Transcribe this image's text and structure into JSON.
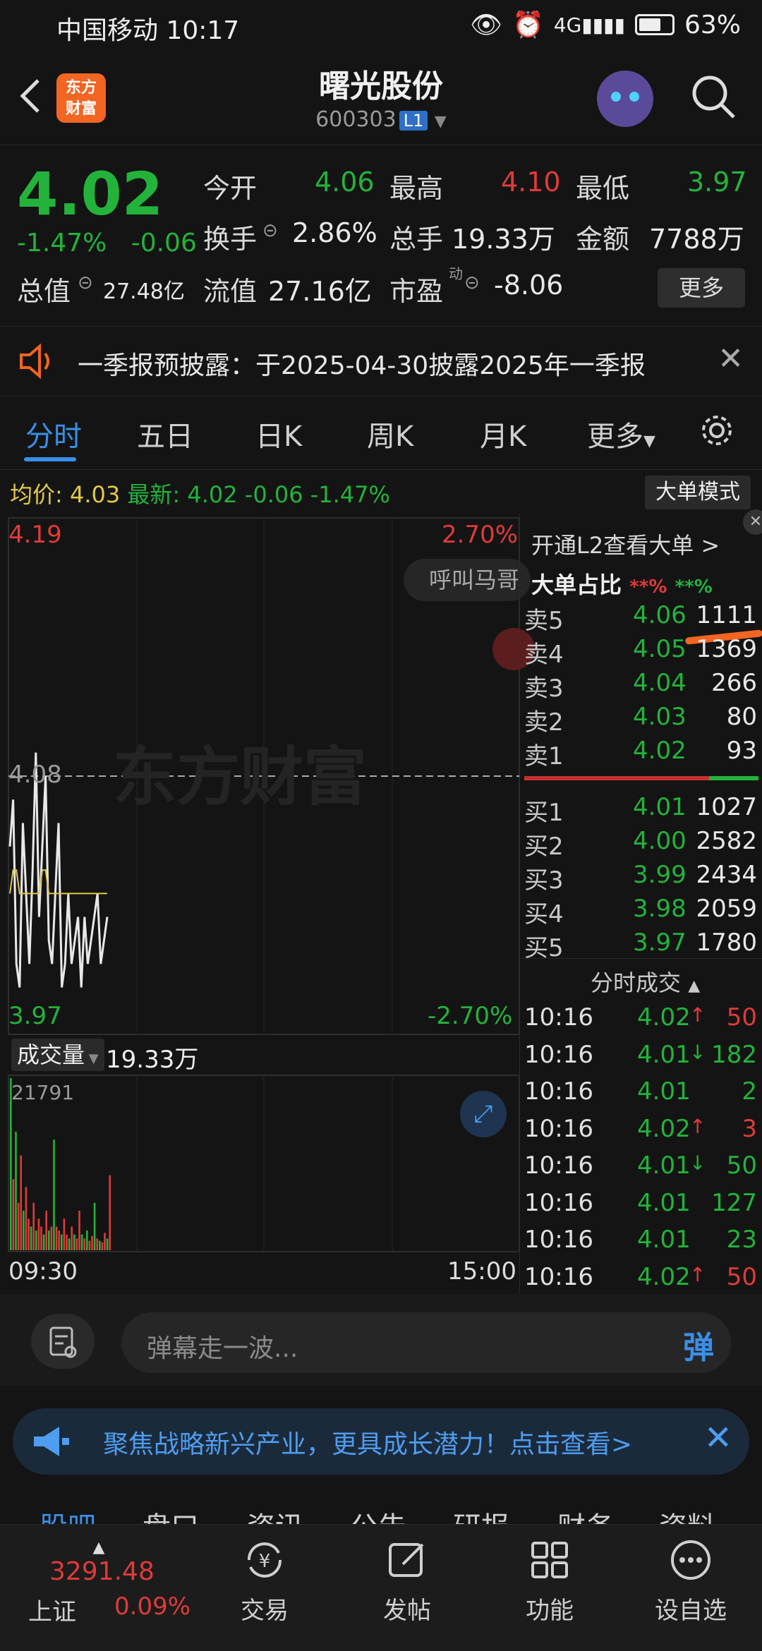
{
  "status_bar": {
    "carrier_time": "中国移动 10:17",
    "battery": "63%"
  },
  "header": {
    "back": "<",
    "logo_line1": "东方",
    "logo_line2": "财富",
    "title": "曙光股份",
    "code": "600303",
    "level": "L1"
  },
  "quote": {
    "price": "4.02",
    "pct": "-1.47%",
    "change": "-0.06",
    "open_label": "今开",
    "open": "4.06",
    "high_label": "最高",
    "high": "4.10",
    "low_label": "最低",
    "low": "3.97",
    "turnover_label": "换手",
    "turnover": "2.86%",
    "volume_label": "总手",
    "volume": "19.33万",
    "amount_label": "金额",
    "amount": "7788万",
    "mktcap_label": "总值",
    "mktcap": "27.48亿",
    "float_label": "流值",
    "float": "27.16亿",
    "pe_label": "市盈",
    "pe_sup": "动",
    "pe": "-8.06",
    "more": "更多"
  },
  "notice": {
    "text": "一季报预披露：于2025-04-30披露2025年一季报"
  },
  "tabs": [
    "分时",
    "五日",
    "日K",
    "周K",
    "月K",
    "更多"
  ],
  "avg_row": {
    "avg_label": "均价:",
    "avg": "4.03",
    "latest_label": "最新:",
    "latest": "4.02",
    "chg": "-0.06",
    "pct": "-1.47%",
    "big_mode": "大单模式"
  },
  "chart_labels": {
    "high_price": "4.19",
    "high_pct": "2.70%",
    "mid_price": "4.08",
    "low_price": "3.97",
    "low_pct": "-2.70%",
    "watermark": "东方财富",
    "call_btn": "呼叫马哥",
    "vol_label": "成交量",
    "vol_value": "19.33万",
    "vol_max": "21791",
    "time_start": "09:30",
    "time_end": "15:00"
  },
  "chart_data": {
    "type": "line",
    "x_labels": [
      "09:30",
      "15:00"
    ],
    "ylim": [
      3.97,
      4.19
    ],
    "series": [
      {
        "values": [
          4.05,
          4.07,
          4.0,
          3.99,
          4.06,
          4.03,
          4.0,
          4.04,
          4.09,
          4.02,
          4.05,
          4.08,
          4.01,
          4.0,
          4.03,
          4.06,
          3.99,
          4.0,
          4.03,
          4.0,
          4.01,
          4.02,
          3.99,
          4.02,
          4.0,
          4.01,
          4.02,
          4.03,
          4.0,
          4.01,
          4.02
        ]
      },
      {
        "values": [
          4.03,
          4.04,
          4.04,
          4.03,
          4.03,
          4.03,
          4.03,
          4.03,
          4.03,
          4.03,
          4.04,
          4.04,
          4.03,
          4.03,
          4.03,
          4.03,
          4.03,
          4.03,
          4.03,
          4.03,
          4.03,
          4.03,
          4.03,
          4.03,
          4.03,
          4.03,
          4.03,
          4.03,
          4.03,
          4.03,
          4.03
        ]
      }
    ],
    "volume": {
      "ylim": [
        0,
        21791
      ],
      "values": [
        21791,
        9000,
        15000,
        6000,
        12000,
        5000,
        8000,
        4000,
        3000,
        6000,
        2500,
        4000,
        3000,
        2000,
        5000,
        2500,
        3000,
        14000,
        3000,
        2500,
        2000,
        4000,
        2000,
        1500,
        3000,
        2000,
        1500,
        5000,
        2000,
        1500,
        2500,
        1200,
        1800,
        6000,
        1500,
        1200,
        1000,
        2200,
        1500,
        9500
      ],
      "colors": [
        "green",
        "red",
        "green",
        "red",
        "red",
        "green",
        "red",
        "red",
        "green",
        "red",
        "green",
        "red",
        "red",
        "green",
        "red",
        "green",
        "red",
        "green",
        "red",
        "red",
        "green",
        "red",
        "red",
        "green",
        "red",
        "green",
        "red",
        "red",
        "green",
        "red",
        "green",
        "red",
        "red",
        "green",
        "red",
        "green",
        "red",
        "red",
        "green",
        "red"
      ]
    }
  },
  "order_book": {
    "l2_link": "开通L2查看大单 >",
    "ratio_label": "大单占比",
    "ratio_red": "**%",
    "ratio_green": "**%",
    "asks": [
      {
        "name": "卖5",
        "price": "4.06",
        "vol": "1111"
      },
      {
        "name": "卖4",
        "price": "4.05",
        "vol": "1369"
      },
      {
        "name": "卖3",
        "price": "4.04",
        "vol": "266"
      },
      {
        "name": "卖2",
        "price": "4.03",
        "vol": "80"
      },
      {
        "name": "卖1",
        "price": "4.02",
        "vol": "93"
      }
    ],
    "bids": [
      {
        "name": "买1",
        "price": "4.01",
        "vol": "1027"
      },
      {
        "name": "买2",
        "price": "4.00",
        "vol": "2582"
      },
      {
        "name": "买3",
        "price": "3.99",
        "vol": "2434"
      },
      {
        "name": "买4",
        "price": "3.98",
        "vol": "2059"
      },
      {
        "name": "买5",
        "price": "3.97",
        "vol": "1780"
      }
    ]
  },
  "trades": {
    "title": "分时成交",
    "rows": [
      {
        "time": "10:16",
        "price": "4.02",
        "arrow": "↑",
        "vol": "50",
        "dir": "up"
      },
      {
        "time": "10:16",
        "price": "4.01",
        "arrow": "↓",
        "vol": "182",
        "dir": "down"
      },
      {
        "time": "10:16",
        "price": "4.01",
        "arrow": "",
        "vol": "2",
        "dir": "down"
      },
      {
        "time": "10:16",
        "price": "4.02",
        "arrow": "↑",
        "vol": "3",
        "dir": "up"
      },
      {
        "time": "10:16",
        "price": "4.01",
        "arrow": "↓",
        "vol": "50",
        "dir": "down"
      },
      {
        "time": "10:16",
        "price": "4.01",
        "arrow": "",
        "vol": "127",
        "dir": "down"
      },
      {
        "time": "10:16",
        "price": "4.01",
        "arrow": "",
        "vol": "23",
        "dir": "down"
      },
      {
        "time": "10:16",
        "price": "4.02",
        "arrow": "↑",
        "vol": "50",
        "dir": "up"
      }
    ]
  },
  "barrage": {
    "placeholder": "弹幕走一波...",
    "send": "弹"
  },
  "promo": {
    "text": "聚焦战略新兴产业，更具成长潜力！点击查看>"
  },
  "sub_tabs": [
    "股吧",
    "盘口",
    "资讯",
    "公告",
    "研报",
    "财务",
    "资料"
  ],
  "bottom_nav": {
    "index_value": "3291.48",
    "index_name": "上证",
    "index_pct": "0.09%",
    "items": [
      "交易",
      "发帖",
      "功能",
      "设自选"
    ]
  }
}
